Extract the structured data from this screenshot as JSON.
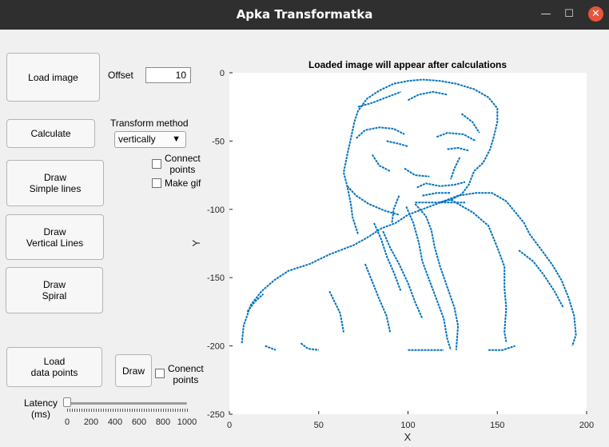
{
  "window": {
    "title": "Apka Transformatka",
    "minimize_icon": "minimize-icon",
    "maximize_icon": "maximize-icon",
    "close_icon": "close-icon"
  },
  "controls": {
    "load_image_label": "Load image",
    "offset_label": "Offset",
    "offset_value": "10",
    "calculate_label": "Calculate",
    "transform_method_label": "Transform method",
    "transform_method_value": "vertically",
    "connect_points_label": "Connect\npoints",
    "make_gif_label": "Make gif",
    "draw_simple_lines_label": "Draw\nSimple lines",
    "draw_vertical_lines_label": "Draw\nVertical Lines",
    "draw_spiral_label": "Draw\nSpiral",
    "load_data_points_label": "Load\ndata points",
    "draw_label": "Draw",
    "conenct_points_label": "Conenct\npoints",
    "latency_label": "Latency\n(ms)",
    "latency_value": 0,
    "latency_ticks": [
      "0",
      "200",
      "400",
      "600",
      "800",
      "1000"
    ]
  },
  "chart_data": {
    "type": "scatter",
    "title": "Loaded image will appear after calculations",
    "xlabel": "X",
    "ylabel": "Y",
    "xlim": [
      0,
      200
    ],
    "ylim": [
      -250,
      0
    ],
    "xticks": [
      "0",
      "50",
      "100",
      "150",
      "200"
    ],
    "yticks": [
      "0",
      "-50",
      "-100",
      "-150",
      "-200",
      "-250"
    ],
    "series_color": "#0072bd",
    "polylines": [
      [
        [
          7,
          -198
        ],
        [
          8,
          -185
        ],
        [
          12,
          -170
        ],
        [
          18,
          -160
        ],
        [
          25,
          -152
        ],
        [
          33,
          -145
        ],
        [
          45,
          -140
        ],
        [
          56,
          -133
        ],
        [
          70,
          -126
        ],
        [
          78,
          -120
        ],
        [
          85,
          -114
        ],
        [
          93,
          -110
        ],
        [
          100,
          -104
        ],
        [
          108,
          -100
        ],
        [
          118,
          -95
        ],
        [
          128,
          -90
        ],
        [
          138,
          -88
        ],
        [
          147,
          -88
        ],
        [
          155,
          -94
        ],
        [
          160,
          -102
        ],
        [
          165,
          -110
        ],
        [
          168,
          -118
        ],
        [
          172,
          -125
        ],
        [
          176,
          -132
        ],
        [
          181,
          -141
        ],
        [
          186,
          -152
        ],
        [
          190,
          -165
        ],
        [
          193,
          -178
        ],
        [
          194,
          -192
        ],
        [
          192,
          -200
        ]
      ],
      [
        [
          72,
          -118
        ],
        [
          69,
          -106
        ],
        [
          68,
          -96
        ],
        [
          66,
          -83
        ],
        [
          64,
          -73
        ],
        [
          66,
          -60
        ],
        [
          68,
          -48
        ],
        [
          70,
          -36
        ],
        [
          72,
          -28
        ],
        [
          77,
          -19
        ],
        [
          84,
          -13
        ],
        [
          92,
          -8
        ],
        [
          100,
          -6
        ],
        [
          108,
          -5
        ],
        [
          118,
          -6
        ],
        [
          127,
          -8
        ],
        [
          137,
          -12
        ],
        [
          145,
          -18
        ],
        [
          150,
          -26
        ],
        [
          150,
          -36
        ],
        [
          148,
          -47
        ],
        [
          146,
          -56
        ],
        [
          142,
          -66
        ],
        [
          137,
          -72
        ],
        [
          134,
          -82
        ],
        [
          130,
          -89
        ],
        [
          124,
          -93
        ],
        [
          117,
          -95
        ]
      ],
      [
        [
          66,
          -83
        ],
        [
          71,
          -90
        ],
        [
          78,
          -96
        ],
        [
          87,
          -101
        ],
        [
          95,
          -104
        ]
      ],
      [
        [
          104,
          -96
        ],
        [
          110,
          -105
        ],
        [
          113,
          -115
        ],
        [
          115,
          -128
        ],
        [
          118,
          -142
        ],
        [
          122,
          -157
        ],
        [
          126,
          -172
        ],
        [
          128,
          -185
        ],
        [
          127,
          -203
        ]
      ],
      [
        [
          99,
          -98
        ],
        [
          103,
          -110
        ],
        [
          106,
          -124
        ],
        [
          108,
          -138
        ],
        [
          112,
          -152
        ],
        [
          116,
          -166
        ],
        [
          120,
          -180
        ],
        [
          122,
          -195
        ],
        [
          124,
          -203
        ]
      ],
      [
        [
          104,
          -95
        ],
        [
          118,
          -95
        ],
        [
          132,
          -95
        ]
      ],
      [
        [
          124,
          -93
        ],
        [
          136,
          -102
        ],
        [
          145,
          -112
        ],
        [
          150,
          -128
        ],
        [
          154,
          -142
        ],
        [
          154,
          -158
        ],
        [
          155,
          -172
        ],
        [
          154,
          -190
        ],
        [
          155,
          -197
        ]
      ],
      [
        [
          71,
          -48
        ],
        [
          76,
          -42
        ],
        [
          84,
          -40
        ],
        [
          92,
          -41
        ],
        [
          98,
          -45
        ]
      ],
      [
        [
          116,
          -47
        ],
        [
          122,
          -44
        ],
        [
          131,
          -45
        ],
        [
          138,
          -50
        ]
      ],
      [
        [
          88,
          -50
        ],
        [
          95,
          -52
        ],
        [
          100,
          -54
        ]
      ],
      [
        [
          122,
          -56
        ],
        [
          128,
          -55
        ],
        [
          134,
          -57
        ]
      ],
      [
        [
          105,
          -84
        ],
        [
          110,
          -81
        ],
        [
          118,
          -83
        ],
        [
          126,
          -82
        ],
        [
          132,
          -80
        ]
      ],
      [
        [
          108,
          -90
        ],
        [
          116,
          -88
        ],
        [
          124,
          -88
        ]
      ],
      [
        [
          95,
          -90
        ],
        [
          92,
          -100
        ],
        [
          91,
          -110
        ]
      ],
      [
        [
          20,
          -200
        ],
        [
          26,
          -203
        ]
      ],
      [
        [
          40,
          -198
        ],
        [
          44,
          -202
        ],
        [
          50,
          -203
        ]
      ],
      [
        [
          100,
          -203
        ],
        [
          110,
          -203
        ],
        [
          120,
          -203
        ]
      ],
      [
        [
          145,
          -203
        ],
        [
          153,
          -203
        ],
        [
          160,
          -200
        ]
      ],
      [
        [
          81,
          -110
        ],
        [
          85,
          -122
        ],
        [
          88,
          -134
        ],
        [
          92,
          -146
        ],
        [
          96,
          -160
        ]
      ],
      [
        [
          86,
          -116
        ],
        [
          90,
          -128
        ],
        [
          95,
          -140
        ],
        [
          100,
          -154
        ],
        [
          104,
          -168
        ],
        [
          108,
          -180
        ]
      ],
      [
        [
          76,
          -140
        ],
        [
          80,
          -153
        ],
        [
          84,
          -166
        ],
        [
          88,
          -178
        ],
        [
          90,
          -190
        ]
      ],
      [
        [
          56,
          -160
        ],
        [
          62,
          -176
        ],
        [
          64,
          -190
        ]
      ],
      [
        [
          72,
          -25
        ],
        [
          80,
          -22
        ],
        [
          88,
          -18
        ],
        [
          96,
          -14
        ]
      ],
      [
        [
          100,
          -20
        ],
        [
          106,
          -16
        ],
        [
          114,
          -14
        ],
        [
          122,
          -16
        ]
      ],
      [
        [
          130,
          -30
        ],
        [
          136,
          -36
        ],
        [
          140,
          -44
        ]
      ],
      [
        [
          80,
          -60
        ],
        [
          84,
          -68
        ],
        [
          90,
          -72
        ]
      ],
      [
        [
          98,
          -70
        ],
        [
          104,
          -75
        ],
        [
          112,
          -76
        ]
      ],
      [
        [
          129,
          -62
        ],
        [
          126,
          -70
        ],
        [
          124,
          -78
        ]
      ],
      [
        [
          162,
          -130
        ],
        [
          170,
          -138
        ],
        [
          176,
          -148
        ],
        [
          182,
          -160
        ],
        [
          187,
          -172
        ]
      ],
      [
        [
          10,
          -175
        ],
        [
          14,
          -168
        ],
        [
          19,
          -162
        ]
      ]
    ]
  }
}
